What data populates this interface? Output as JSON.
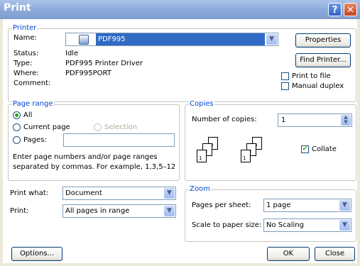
{
  "window": {
    "title": "Print",
    "help_glyph": "?",
    "close_glyph": "✕"
  },
  "printer": {
    "group_label": "Printer",
    "name_label": "Name:",
    "name_value": "PDF995",
    "status_label": "Status:",
    "status_value": "Idle",
    "type_label": "Type:",
    "type_value": "PDF995 Printer Driver",
    "where_label": "Where:",
    "where_value": "PDF995PORT",
    "comment_label": "Comment:",
    "properties_button": "Properties",
    "find_printer_button": "Find Printer...",
    "print_to_file_label": "Print to file",
    "manual_duplex_label": "Manual duplex",
    "print_to_file_checked": false,
    "manual_duplex_checked": false
  },
  "page_range": {
    "group_label": "Page range",
    "all_label": "All",
    "current_page_label": "Current page",
    "selection_label": "Selection",
    "pages_label": "Pages:",
    "pages_value": "",
    "hint_line1": "Enter page numbers and/or page ranges",
    "hint_line2": "separated by commas.  For example, 1,3,5–12",
    "selected": "all"
  },
  "copies": {
    "group_label": "Copies",
    "number_label": "Number of copies:",
    "number_value": "1",
    "collate_label": "Collate",
    "collate_checked": true,
    "stack_labels": [
      "3",
      "2",
      "1"
    ]
  },
  "print_what": {
    "label": "Print what:",
    "value": "Document"
  },
  "print": {
    "label": "Print:",
    "value": "All pages in range"
  },
  "zoom": {
    "group_label": "Zoom",
    "pages_per_sheet_label": "Pages per sheet:",
    "pages_per_sheet_value": "1 page",
    "scale_label": "Scale to paper size:",
    "scale_value": "No Scaling"
  },
  "footer": {
    "options_button": "Options...",
    "ok_button": "OK",
    "close_button": "Close"
  },
  "colors": {
    "titlebar": "#8ba9d8",
    "group_label": "#0046d5",
    "selection_highlight": "#316ac5"
  }
}
